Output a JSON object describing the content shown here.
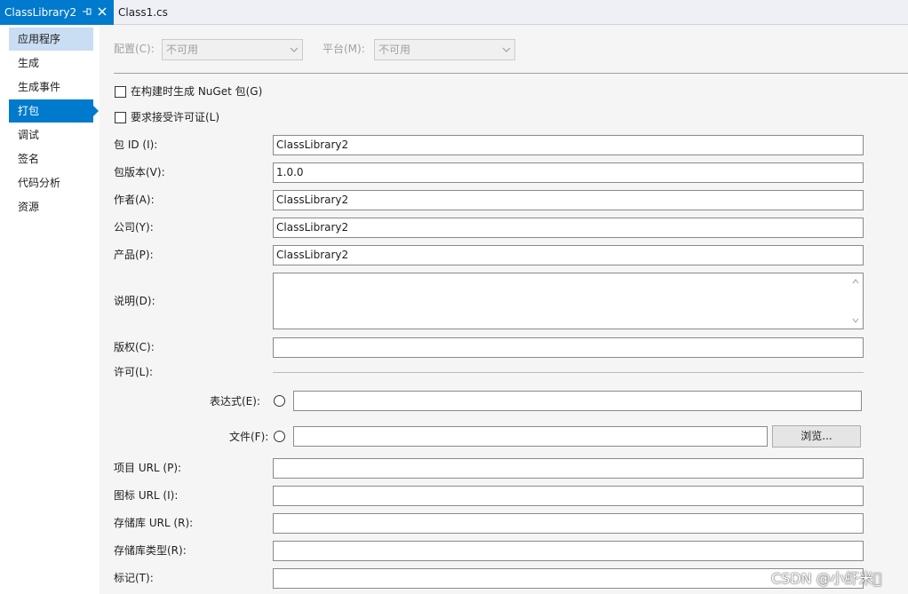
{
  "tabs": {
    "active": {
      "label": "ClassLibrary2",
      "pin_glyph": "←┃"
    },
    "inactive": {
      "label": "Class1.cs"
    }
  },
  "nav": {
    "items": [
      {
        "label": "应用程序"
      },
      {
        "label": "生成"
      },
      {
        "label": "生成事件"
      },
      {
        "label": "打包"
      },
      {
        "label": "调试"
      },
      {
        "label": "签名"
      },
      {
        "label": "代码分析"
      },
      {
        "label": "资源"
      }
    ]
  },
  "config": {
    "config_label": "配置(C):",
    "config_value": "不可用",
    "platform_label": "平台(M):",
    "platform_value": "不可用"
  },
  "checks": {
    "nuget": "在构建时生成 NuGet 包(G)",
    "license": "要求接受许可证(L)"
  },
  "fields": {
    "package_id": {
      "label": "包 ID (I):",
      "value": "ClassLibrary2"
    },
    "version": {
      "label": "包版本(V):",
      "value": "1.0.0"
    },
    "authors": {
      "label": "作者(A):",
      "value": "ClassLibrary2"
    },
    "company": {
      "label": "公司(Y):",
      "value": "ClassLibrary2"
    },
    "product": {
      "label": "产品(P):",
      "value": "ClassLibrary2"
    },
    "description": {
      "label": "说明(D):",
      "value": ""
    },
    "copyright": {
      "label": "版权(C):",
      "value": ""
    },
    "license": {
      "label": "许可(L):"
    },
    "expression": {
      "label": "表达式(E):",
      "value": ""
    },
    "file": {
      "label": "文件(F):",
      "value": "",
      "browse": "浏览..."
    },
    "project_url": {
      "label": "项目 URL (P):",
      "value": ""
    },
    "icon_url": {
      "label": "图标 URL (I):",
      "value": ""
    },
    "repo_url": {
      "label": "存储库 URL (R):",
      "value": ""
    },
    "repo_type": {
      "label": "存储库类型(R):",
      "value": ""
    },
    "tags": {
      "label": "标记(T):",
      "value": ""
    }
  },
  "watermark": "CSDN @小虾米\u0000",
  "colors": {
    "accent": "#007acc",
    "nav_hover": "#c9ddf3",
    "panel_bg": "#f5f5f5"
  }
}
